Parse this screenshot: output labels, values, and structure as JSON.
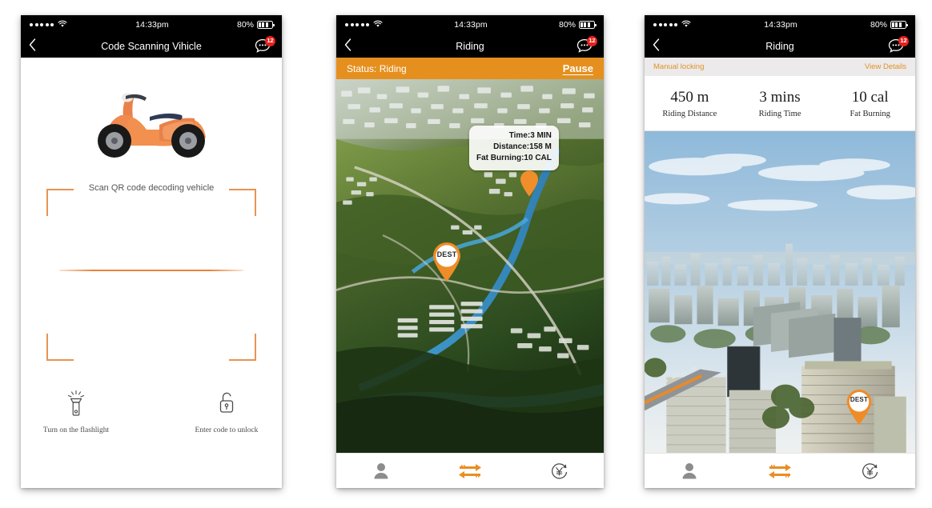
{
  "status_bar": {
    "time": "14:33pm",
    "battery_pct": "80%",
    "signal_icon": "signal-dots-icon",
    "wifi_icon": "wifi-icon",
    "battery_icon": "battery-icon"
  },
  "colors": {
    "accent_orange": "#e5901e",
    "scan_orange": "#e9833a",
    "badge_red": "#e8201c",
    "nav_black": "#000000",
    "subbar_gray": "#eceaea",
    "subbar_text": "#e0922a"
  },
  "screen1": {
    "nav": {
      "back_icon": "chevron-left-icon",
      "title": "Code Scanning Vihicle",
      "chat_icon": "chat-bubble-icon",
      "badge": "12"
    },
    "hero_icon": "scooter-illustration",
    "scan_hint": "Scan QR code decoding vehicle",
    "scan_line_icon": "scan-line",
    "actions": [
      {
        "icon": "flashlight-icon",
        "label": "Turn on the flashlight"
      },
      {
        "icon": "unlock-padlock-icon",
        "label": "Enter code to unlock"
      }
    ]
  },
  "screen2": {
    "nav": {
      "back_icon": "chevron-left-icon",
      "title": "Riding",
      "chat_icon": "chat-bubble-icon",
      "badge": "12"
    },
    "status_strip": {
      "status_text": "Status: Riding",
      "pause_label": "Pause"
    },
    "map": {
      "image_icon": "aerial-city-map",
      "callout": {
        "time": "Time:3 MIN",
        "distance": "Distance:158 M",
        "fat_burning": "Fat Burning:10 CAL"
      },
      "current_pin_icon": "location-pin-icon",
      "dest_pin_icon": "destination-pin-icon",
      "dest_label": "DEST"
    },
    "tabs": [
      {
        "icon": "user-profile-icon",
        "active": false
      },
      {
        "icon": "bidirectional-arrows-icon",
        "active": true
      },
      {
        "icon": "yen-refund-icon",
        "active": false
      }
    ]
  },
  "screen3": {
    "nav": {
      "back_icon": "chevron-left-icon",
      "title": "Riding",
      "chat_icon": "chat-bubble-icon",
      "badge": "12"
    },
    "subbar": {
      "manual_locking": "Manual locking",
      "view_details": "View Details"
    },
    "stats": [
      {
        "value": "450 m",
        "label": "Riding Distance"
      },
      {
        "value": "3 mins",
        "label": "Riding Time"
      },
      {
        "value": "10 cal",
        "label": "Fat Burning"
      }
    ],
    "photo": {
      "image_icon": "city-skyline-photo",
      "dest_pin_icon": "destination-pin-icon",
      "dest_label": "DEST"
    },
    "tabs": [
      {
        "icon": "user-profile-icon",
        "active": false
      },
      {
        "icon": "bidirectional-arrows-icon",
        "active": true
      },
      {
        "icon": "yen-refund-icon",
        "active": false
      }
    ]
  }
}
